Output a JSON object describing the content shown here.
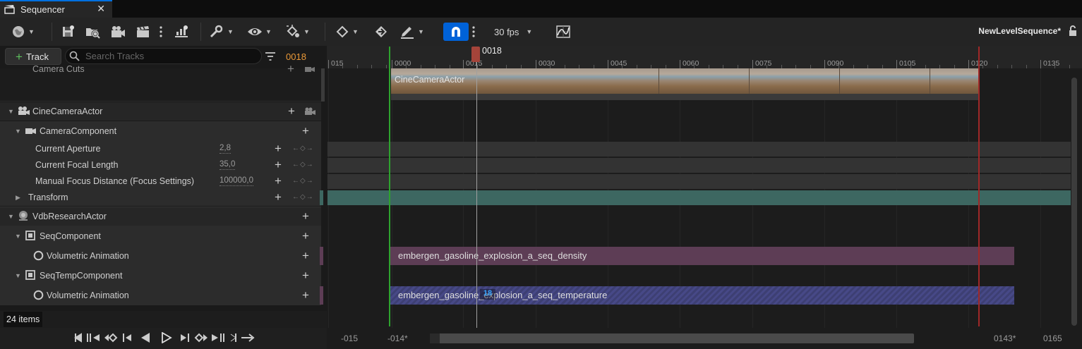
{
  "window": {
    "tab_title": "Sequencer",
    "close_glyph": "✕"
  },
  "toolbar": {
    "fps": "30 fps",
    "sequence_name": "NewLevelSequence*",
    "snap_active": true
  },
  "tracks_panel": {
    "add_track_label": "Track",
    "search_placeholder": "Search Tracks",
    "current_frame": "0018",
    "rows": [
      {
        "label": "Camera Cuts"
      },
      {
        "label": "CineCameraActor"
      },
      {
        "label": "CameraComponent"
      },
      {
        "label": "Current Aperture",
        "value": "2,8"
      },
      {
        "label": "Current Focal Length",
        "value": "35,0"
      },
      {
        "label": "Manual Focus Distance (Focus Settings)",
        "value": "100000,0"
      },
      {
        "label": "Transform"
      },
      {
        "label": "VdbResearchActor"
      },
      {
        "label": "SeqComponent"
      },
      {
        "label": "Volumetric Animation"
      },
      {
        "label": "SeqTempComponent"
      },
      {
        "label": "Volumetric Animation"
      }
    ],
    "item_count": "24 items"
  },
  "timeline": {
    "playhead_label": "0018",
    "ruler_labels": [
      "015",
      "0000",
      "0015",
      "0030",
      "0045",
      "0060",
      "0075",
      "0090",
      "0105",
      "0120",
      "0135"
    ],
    "camera_section_label": "CineCameraActor",
    "segments": {
      "density": "embergen_gasoline_explosion_a_seq_density",
      "temperature": "embergen_gasoline_explosion_a_seq_temperature"
    },
    "key_badge": "18",
    "view_range": {
      "left_start": "-015",
      "left_in": "-014*",
      "right_out": "0143*",
      "right_end": "0165"
    }
  },
  "colors": {
    "accent": "#0062d8",
    "frame_orange": "#e99838",
    "playhead": "#a5443a",
    "start_green": "#2ea32e",
    "end_red": "#a02828",
    "density_section": "#5d3d55",
    "temperature_section": "#474987",
    "transform_section": "#3d6761"
  },
  "icons": [
    "sequencer-icon",
    "world-icon",
    "save-icon",
    "browse-icon",
    "render-movie-icon",
    "clapper-icon",
    "more-icon",
    "actor-to-sequencer-icon",
    "tools-icon",
    "visibility-icon",
    "transform-icon",
    "keyframe-icon",
    "key-interpolation-icon",
    "pen-icon",
    "snap-magnet-icon",
    "curve-editor-icon",
    "lock-icon"
  ]
}
